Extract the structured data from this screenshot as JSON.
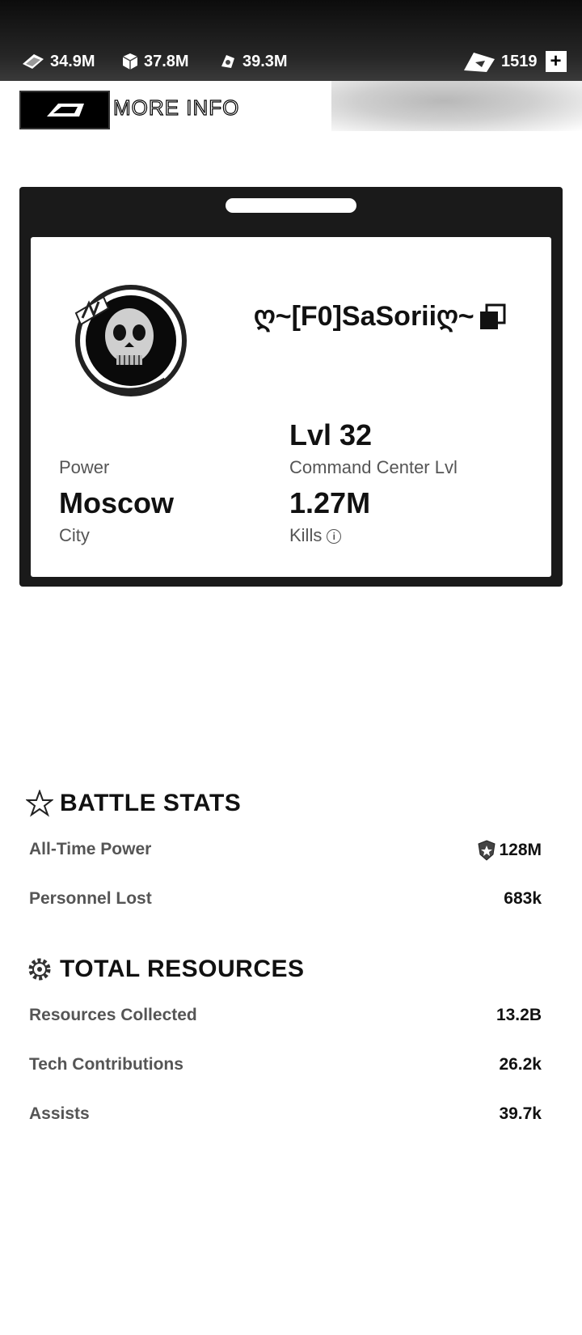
{
  "topbar": {
    "resources": [
      {
        "icon": "cash-icon",
        "value": "34.9M"
      },
      {
        "icon": "supply-crate-icon",
        "value": "37.8M"
      },
      {
        "icon": "fuel-icon",
        "value": "39.3M"
      }
    ],
    "currency": {
      "icon": "gold-icon",
      "value": "1519"
    },
    "add_label": "+"
  },
  "header": {
    "back_icon": "back-arrow-icon",
    "title": "MORE INFO"
  },
  "profile": {
    "avatar_icon": "skull-emblem-icon",
    "name": "ღ~[F0]SaSoriiღ~",
    "copy_icon": "copy-icon",
    "power_label": "Power",
    "level_value": "Lvl 32",
    "level_label": "Command Center Lvl",
    "city_value": "Moscow",
    "city_label": "City",
    "kills_value": "1.27M",
    "kills_label": "Kills",
    "kills_info_icon": "info-icon"
  },
  "battle_stats": {
    "icon": "star-icon",
    "title": "BATTLE STATS",
    "rows": [
      {
        "label": "All-Time Power",
        "value": "128M",
        "icon": "shield-icon"
      },
      {
        "label": "Personnel Lost",
        "value": "683k"
      }
    ]
  },
  "total_resources": {
    "icon": "gear-icon",
    "title": "TOTAL RESOURCES",
    "rows": [
      {
        "label": "Resources Collected",
        "value": "13.2B"
      },
      {
        "label": "Tech Contributions",
        "value": "26.2k"
      },
      {
        "label": "Assists",
        "value": "39.7k"
      }
    ]
  }
}
